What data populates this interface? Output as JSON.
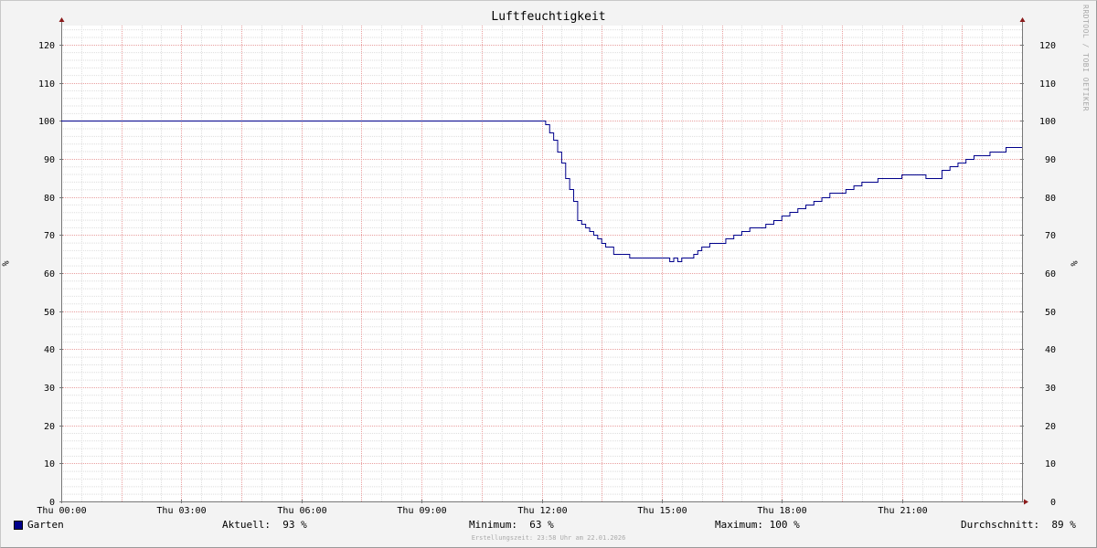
{
  "chart_data": {
    "type": "line",
    "title": "Luftfeuchtigkeit",
    "ylabel": "%",
    "ylim": [
      0,
      125
    ],
    "yticks": [
      0,
      10,
      20,
      30,
      40,
      50,
      60,
      70,
      80,
      90,
      100,
      110,
      120
    ],
    "ytick_labels": [
      "0",
      "10",
      "20",
      "30",
      "40",
      "50",
      "60",
      "70",
      "80",
      "90",
      "100",
      "110",
      "120"
    ],
    "xlim": [
      0,
      24
    ],
    "xticks": [
      0,
      3,
      6,
      9,
      12,
      15,
      18,
      21
    ],
    "xtick_labels": [
      "Thu 00:00",
      "Thu 03:00",
      "Thu 06:00",
      "Thu 09:00",
      "Thu 12:00",
      "Thu 15:00",
      "Thu 18:00",
      "Thu 21:00"
    ],
    "grid": true,
    "series": [
      {
        "name": "Garten",
        "color": "#00008b",
        "x": [
          0,
          12.0,
          12.1,
          12.2,
          12.3,
          12.4,
          12.5,
          12.6,
          12.7,
          12.8,
          12.9,
          13.0,
          13.1,
          13.2,
          13.3,
          13.4,
          13.5,
          13.6,
          13.8,
          14.0,
          14.2,
          14.4,
          14.6,
          14.8,
          15.0,
          15.2,
          15.3,
          15.4,
          15.5,
          15.6,
          15.7,
          15.8,
          15.9,
          16.0,
          16.2,
          16.4,
          16.6,
          16.8,
          17.0,
          17.2,
          17.4,
          17.6,
          17.8,
          18.0,
          18.2,
          18.4,
          18.6,
          18.8,
          19.0,
          19.2,
          19.4,
          19.6,
          19.8,
          20.0,
          20.2,
          20.4,
          20.6,
          20.8,
          21.0,
          21.2,
          21.4,
          21.6,
          21.8,
          22.0,
          22.2,
          22.4,
          22.6,
          22.8,
          23.0,
          23.2,
          23.4,
          23.6,
          24.0
        ],
        "y": [
          100,
          100,
          99,
          97,
          95,
          92,
          89,
          85,
          82,
          79,
          74,
          73,
          72,
          71,
          70,
          69,
          68,
          67,
          65,
          65,
          64,
          64,
          64,
          64,
          64,
          63,
          64,
          63,
          64,
          64,
          64,
          65,
          66,
          67,
          68,
          68,
          69,
          70,
          71,
          72,
          72,
          73,
          74,
          75,
          76,
          77,
          78,
          79,
          80,
          81,
          81,
          82,
          83,
          84,
          84,
          85,
          85,
          85,
          86,
          86,
          86,
          85,
          85,
          87,
          88,
          89,
          90,
          91,
          91,
          92,
          92,
          93,
          93
        ]
      }
    ]
  },
  "legend": {
    "series_name": "Garten",
    "current": "Aktuell:  93 %",
    "minimum": "Minimum:  63 %",
    "maximum": "Maximum: 100 %",
    "average": "Durchschnitt:  89 %"
  },
  "footer": "Erstellungszeit: 23:58 Uhr am 22.01.2026",
  "watermark": "RRDTOOL / TOBI OETIKER"
}
